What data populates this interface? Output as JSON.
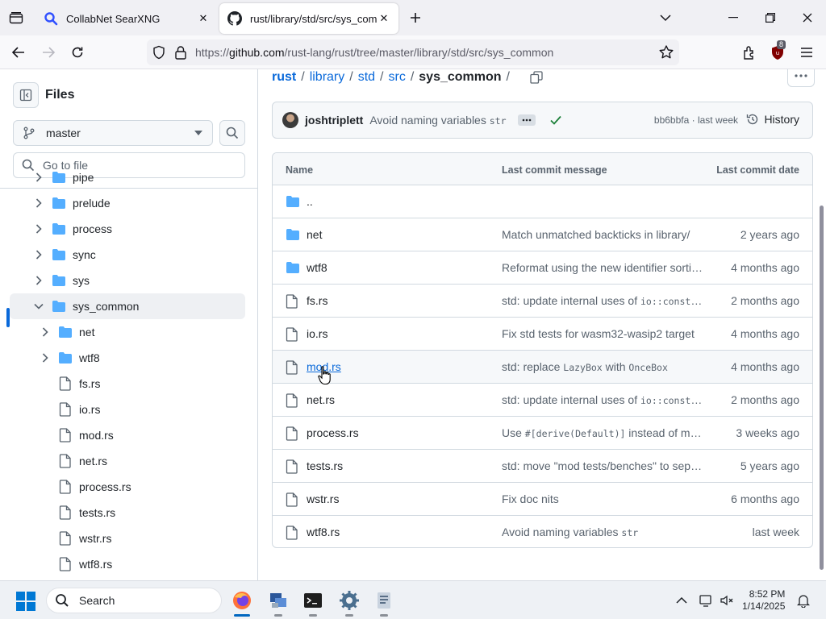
{
  "browser": {
    "tabs": [
      {
        "title": "CollabNet SearXNG",
        "active": false,
        "icon": "search-favicon"
      },
      {
        "title": "rust/library/std/src/sys_commo",
        "active": true,
        "icon": "github-favicon"
      }
    ],
    "url": {
      "prefix": "https://",
      "host": "github.com",
      "path": "/rust-lang/rust/tree/master/library/std/src/sys_common"
    },
    "extension_badge": "8"
  },
  "sidebar": {
    "title": "Files",
    "branch": "master",
    "goto_placeholder": "Go to file",
    "tree": [
      {
        "label": "pipe",
        "type": "dir",
        "depth": 1,
        "expanded": false
      },
      {
        "label": "prelude",
        "type": "dir",
        "depth": 1,
        "expanded": false
      },
      {
        "label": "process",
        "type": "dir",
        "depth": 1,
        "expanded": false
      },
      {
        "label": "sync",
        "type": "dir",
        "depth": 1,
        "expanded": false
      },
      {
        "label": "sys",
        "type": "dir",
        "depth": 1,
        "expanded": false
      },
      {
        "label": "sys_common",
        "type": "dir",
        "depth": 1,
        "expanded": true,
        "selected": true
      },
      {
        "label": "net",
        "type": "dir",
        "depth": 2,
        "expanded": false
      },
      {
        "label": "wtf8",
        "type": "dir",
        "depth": 2,
        "expanded": false
      },
      {
        "label": "fs.rs",
        "type": "file",
        "depth": 2
      },
      {
        "label": "io.rs",
        "type": "file",
        "depth": 2
      },
      {
        "label": "mod.rs",
        "type": "file",
        "depth": 2
      },
      {
        "label": "net.rs",
        "type": "file",
        "depth": 2
      },
      {
        "label": "process.rs",
        "type": "file",
        "depth": 2
      },
      {
        "label": "tests.rs",
        "type": "file",
        "depth": 2
      },
      {
        "label": "wstr.rs",
        "type": "file",
        "depth": 2
      },
      {
        "label": "wtf8.rs",
        "type": "file",
        "depth": 2
      }
    ]
  },
  "breadcrumb": {
    "parts": [
      "rust",
      "library",
      "std",
      "src"
    ],
    "current": "sys_common",
    "separator": "/"
  },
  "latest_commit": {
    "author": "joshtriplett",
    "message_prefix": "Avoid naming variables ",
    "message_code": "str",
    "sha": "bb6bbfa",
    "time": "last week",
    "sha_time_sep": " · ",
    "history_label": "History"
  },
  "table": {
    "headers": {
      "name": "Name",
      "message": "Last commit message",
      "date": "Last commit date"
    },
    "rows": [
      {
        "name": "..",
        "type": "dir",
        "message": [],
        "date": ""
      },
      {
        "name": "net",
        "type": "dir",
        "message": [
          {
            "t": "Match unmatched backticks in library/"
          }
        ],
        "date": "2 years ago"
      },
      {
        "name": "wtf8",
        "type": "dir",
        "message": [
          {
            "t": "Reformat using the new identifier sorting algorithm"
          }
        ],
        "date": "4 months ago"
      },
      {
        "name": "fs.rs",
        "type": "file",
        "message": [
          {
            "t": "std: update internal uses of "
          },
          {
            "c": "io::const_error"
          }
        ],
        "date": "2 months ago"
      },
      {
        "name": "io.rs",
        "type": "file",
        "message": [
          {
            "t": "Fix std tests for wasm32-wasip2 target"
          }
        ],
        "date": "4 months ago"
      },
      {
        "name": "mod.rs",
        "type": "file",
        "hover": true,
        "message": [
          {
            "t": "std: replace "
          },
          {
            "c": "LazyBox"
          },
          {
            "t": " with "
          },
          {
            "c": "OnceBox"
          }
        ],
        "date": "4 months ago"
      },
      {
        "name": "net.rs",
        "type": "file",
        "message": [
          {
            "t": "std: update internal uses of "
          },
          {
            "c": "io::const_error"
          }
        ],
        "date": "2 months ago"
      },
      {
        "name": "process.rs",
        "type": "file",
        "message": [
          {
            "t": "Use "
          },
          {
            "c": "#[derive(Default)]"
          },
          {
            "t": " instead of manually implementing it"
          }
        ],
        "date": "3 weeks ago"
      },
      {
        "name": "tests.rs",
        "type": "file",
        "message": [
          {
            "t": "std: move \"mod tests/benches\" to separate files"
          }
        ],
        "date": "5 years ago"
      },
      {
        "name": "wstr.rs",
        "type": "file",
        "message": [
          {
            "t": "Fix doc nits"
          }
        ],
        "date": "6 months ago"
      },
      {
        "name": "wtf8.rs",
        "type": "file",
        "message": [
          {
            "t": "Avoid naming variables "
          },
          {
            "c": "str"
          }
        ],
        "date": "last week"
      }
    ]
  },
  "taskbar": {
    "search_label": "Search",
    "time": "8:52 PM",
    "date": "1/14/2025"
  },
  "colors": {
    "link": "#0969da",
    "folder": "#54aeff",
    "muted": "#59636e",
    "accent": "#0067c0"
  }
}
